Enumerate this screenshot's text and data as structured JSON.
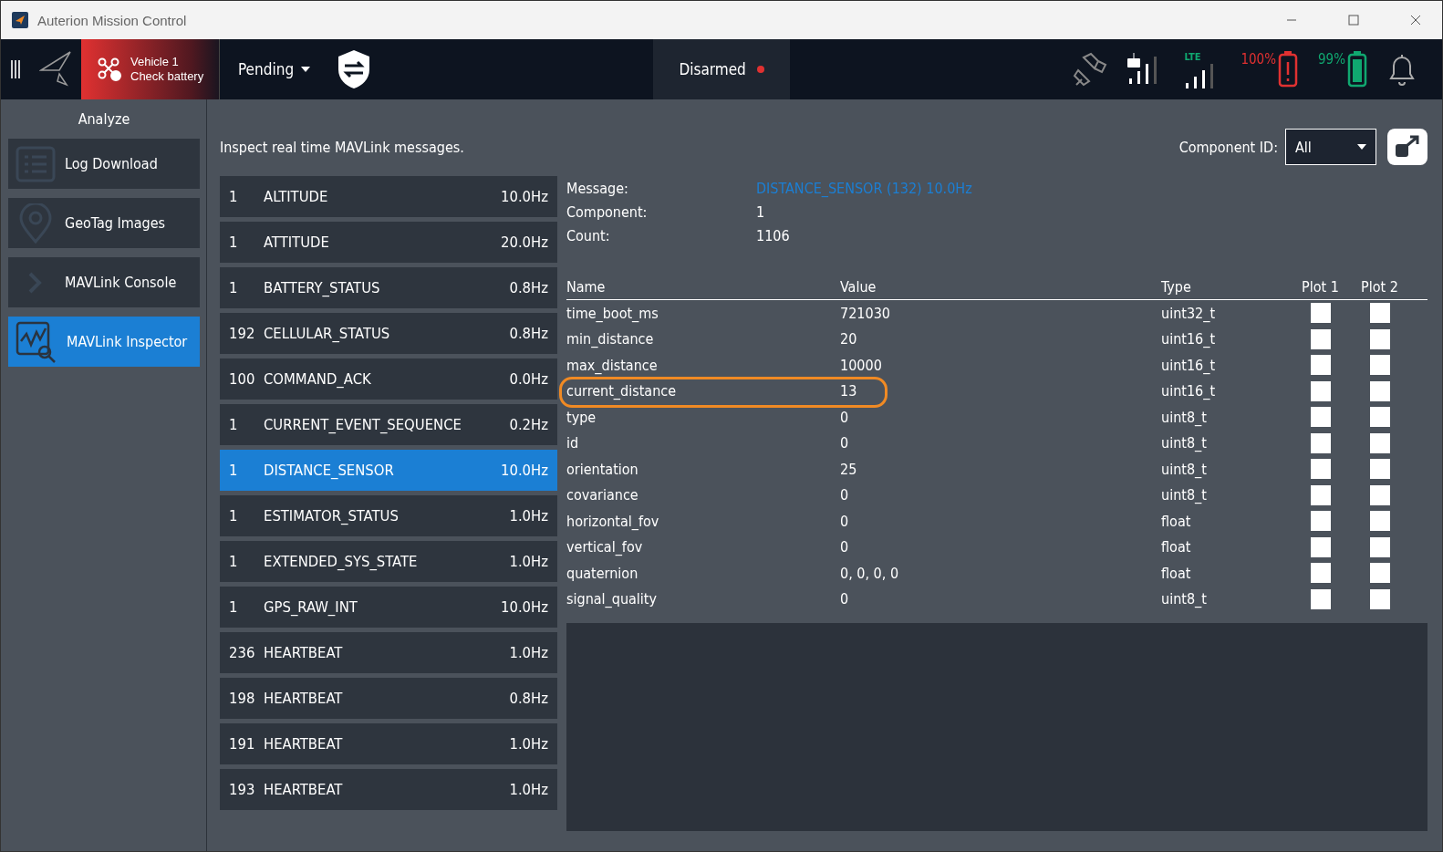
{
  "window": {
    "title": "Auterion Mission Control"
  },
  "toolbar": {
    "vehicle": {
      "name": "Vehicle 1",
      "status": "Check battery"
    },
    "mode": "Pending",
    "arm_state": "Disarmed",
    "lte_label": "LTE",
    "vehicle_battery": "100%",
    "controller_battery": "99%"
  },
  "sidebar": {
    "title": "Analyze",
    "items": [
      {
        "label": "Log Download",
        "kind": "list",
        "selected": false
      },
      {
        "label": "GeoTag Images",
        "kind": "pin",
        "selected": false
      },
      {
        "label": "MAVLink Console",
        "kind": "console",
        "selected": false
      },
      {
        "label": "MAVLink Inspector",
        "kind": "inspector",
        "selected": true
      }
    ]
  },
  "description": "Inspect real time MAVLink messages.",
  "component_filter": {
    "label": "Component ID:",
    "value": "All"
  },
  "messages": [
    {
      "component": "1",
      "name": "ALTITUDE",
      "rate": "10.0Hz",
      "selected": false
    },
    {
      "component": "1",
      "name": "ATTITUDE",
      "rate": "20.0Hz",
      "selected": false
    },
    {
      "component": "1",
      "name": "BATTERY_STATUS",
      "rate": "0.8Hz",
      "selected": false
    },
    {
      "component": "192",
      "name": "CELLULAR_STATUS",
      "rate": "0.8Hz",
      "selected": false
    },
    {
      "component": "100",
      "name": "COMMAND_ACK",
      "rate": "0.0Hz",
      "selected": false
    },
    {
      "component": "1",
      "name": "CURRENT_EVENT_SEQUENCE",
      "rate": "0.2Hz",
      "selected": false
    },
    {
      "component": "1",
      "name": "DISTANCE_SENSOR",
      "rate": "10.0Hz",
      "selected": true
    },
    {
      "component": "1",
      "name": "ESTIMATOR_STATUS",
      "rate": "1.0Hz",
      "selected": false
    },
    {
      "component": "1",
      "name": "EXTENDED_SYS_STATE",
      "rate": "1.0Hz",
      "selected": false
    },
    {
      "component": "1",
      "name": "GPS_RAW_INT",
      "rate": "10.0Hz",
      "selected": false
    },
    {
      "component": "236",
      "name": "HEARTBEAT",
      "rate": "1.0Hz",
      "selected": false
    },
    {
      "component": "198",
      "name": "HEARTBEAT",
      "rate": "0.8Hz",
      "selected": false
    },
    {
      "component": "191",
      "name": "HEARTBEAT",
      "rate": "1.0Hz",
      "selected": false
    },
    {
      "component": "193",
      "name": "HEARTBEAT",
      "rate": "1.0Hz",
      "selected": false
    }
  ],
  "details": {
    "info": [
      {
        "label": "Message:",
        "value": "DISTANCE_SENSOR (132) 10.0Hz",
        "kind": "link"
      },
      {
        "label": "Component:",
        "value": "1",
        "kind": "plain"
      },
      {
        "label": "Count:",
        "value": "1106",
        "kind": "plain"
      }
    ],
    "columns": [
      "Name",
      "Value",
      "Type",
      "Plot 1",
      "Plot 2"
    ],
    "fields": [
      {
        "name": "time_boot_ms",
        "value": "721030",
        "type": "uint32_t",
        "plot1": false,
        "plot2": false,
        "highlighted": false
      },
      {
        "name": "min_distance",
        "value": "20",
        "type": "uint16_t",
        "plot1": false,
        "plot2": false,
        "highlighted": false
      },
      {
        "name": "max_distance",
        "value": "10000",
        "type": "uint16_t",
        "plot1": false,
        "plot2": false,
        "highlighted": false
      },
      {
        "name": "current_distance",
        "value": "13",
        "type": "uint16_t",
        "plot1": false,
        "plot2": false,
        "highlighted": true
      },
      {
        "name": "type",
        "value": "0",
        "type": "uint8_t",
        "plot1": false,
        "plot2": false,
        "highlighted": false
      },
      {
        "name": "id",
        "value": "0",
        "type": "uint8_t",
        "plot1": false,
        "plot2": false,
        "highlighted": false
      },
      {
        "name": "orientation",
        "value": "25",
        "type": "uint8_t",
        "plot1": false,
        "plot2": false,
        "highlighted": false
      },
      {
        "name": "covariance",
        "value": "0",
        "type": "uint8_t",
        "plot1": false,
        "plot2": false,
        "highlighted": false
      },
      {
        "name": "horizontal_fov",
        "value": "0",
        "type": "float",
        "plot1": false,
        "plot2": false,
        "highlighted": false
      },
      {
        "name": "vertical_fov",
        "value": "0",
        "type": "float",
        "plot1": false,
        "plot2": false,
        "highlighted": false
      },
      {
        "name": "quaternion",
        "value": "0, 0, 0, 0",
        "type": "float",
        "plot1": false,
        "plot2": false,
        "highlighted": false
      },
      {
        "name": "signal_quality",
        "value": "0",
        "type": "uint8_t",
        "plot1": false,
        "plot2": false,
        "highlighted": false
      }
    ]
  }
}
